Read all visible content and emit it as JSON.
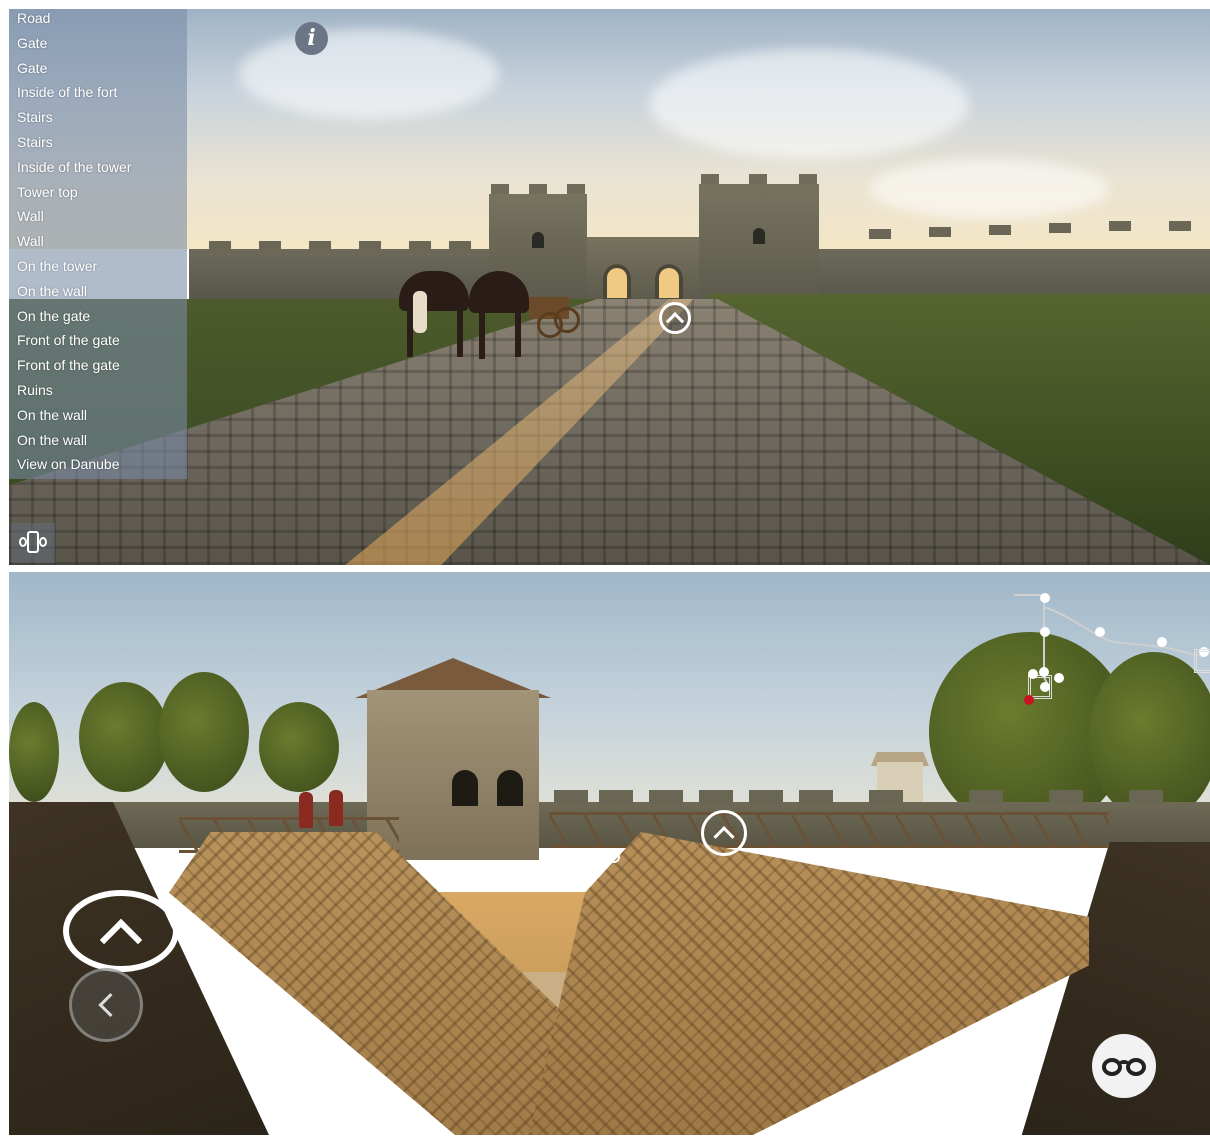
{
  "top_view": {
    "scene_list": [
      "Road",
      "Gate",
      "Gate",
      "Inside of the fort",
      "Stairs",
      "Stairs",
      "Inside of the tower",
      "Tower top",
      "Wall",
      "Wall",
      "On the tower",
      "On the wall",
      "On the gate",
      "Front of the gate",
      "Front of the gate",
      "Ruins",
      "On the wall",
      "On the wall",
      "View on Danube"
    ],
    "info_icon": "info-icon",
    "info_glyph": "i",
    "hotspot_icon": "chevron-up-icon",
    "gyro_icon": "phone-rotate-icon"
  },
  "bottom_view": {
    "forward_icon": "chevron-up-icon",
    "back_icon": "chevron-left-icon",
    "hotspot_icon": "chevron-up-icon",
    "vr_icon": "vr-glasses-icon",
    "minimap_icon": "site-map",
    "minimap_current_color": "#c8141e"
  },
  "colors": {
    "menu_bg": "#788ca5",
    "menu_text": "#ffffff",
    "info_button": "#6c7585",
    "vr_button": "#f2f2f2"
  }
}
